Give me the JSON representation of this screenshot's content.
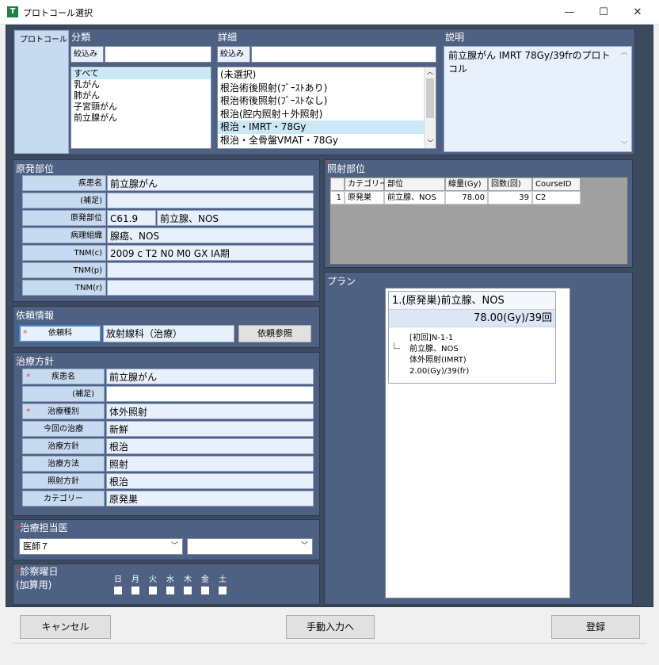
{
  "window": {
    "title": "プロトコール選択",
    "icon_letter": "T",
    "minimize": "—",
    "maximize": "☐",
    "close": "✕"
  },
  "protocol": {
    "tab_label": "プロトコール",
    "bunrui": {
      "title": "分類",
      "filter_label": "絞込み",
      "filter_value": "",
      "items": [
        "すべて",
        "乳がん",
        "肺がん",
        "子宮頸がん",
        "前立腺がん"
      ],
      "selected": 0
    },
    "shosai": {
      "title": "詳細",
      "filter_label": "絞込み",
      "filter_value": "",
      "items": [
        "(未選択)",
        "根治術後照射(ﾌﾞｰｽﾄあり)",
        "根治術後照射(ﾌﾞｰｽﾄなし)",
        "根治(腔内照射＋外照射)",
        "根治・IMRT・78Gy",
        "根治・全骨盤VMAT・78Gy"
      ],
      "selected": 4
    },
    "setsumei": {
      "title": "説明",
      "text": "前立腺がん IMRT 78Gy/39frのプロトコル"
    }
  },
  "genpatsu": {
    "title": "原発部位",
    "rows": [
      {
        "label": "疾患名",
        "value": "前立腺がん"
      },
      {
        "label": "(補足)",
        "value": ""
      },
      {
        "label": "原発部位",
        "value": "C61.9",
        "value2": "前立腺、NOS"
      },
      {
        "label": "病理組織",
        "value": "腺癌、NOS"
      },
      {
        "label": "TNM(c)",
        "value": "2009 c T2 N0 M0 GX ⅠA期"
      },
      {
        "label": "TNM(p)",
        "value": ""
      },
      {
        "label": "TNM(r)",
        "value": ""
      }
    ]
  },
  "irai": {
    "title": "依頼情報",
    "label": "依頼科",
    "value": "放射線科（治療）",
    "ref_button": "依頼参照"
  },
  "chiryo": {
    "title": "治療方針",
    "rows": [
      {
        "label": "疾患名",
        "value": "前立腺がん",
        "required": true
      },
      {
        "label": "(補足)",
        "value": "",
        "required": false
      },
      {
        "label": "治療種別",
        "value": "体外照射",
        "required": true
      },
      {
        "label": "今回の治療",
        "value": "新鮮",
        "required": false
      },
      {
        "label": "治療方針",
        "value": "根治",
        "required": false
      },
      {
        "label": "治療方法",
        "value": "照射",
        "required": false
      },
      {
        "label": "照射方針",
        "value": "根治",
        "required": false
      },
      {
        "label": "カテゴリー",
        "value": "原発巣",
        "required": false
      }
    ]
  },
  "tanto": {
    "title": "治療担当医",
    "doctor": "医師７",
    "second": ""
  },
  "shinsatsu": {
    "title": "診察曜日",
    "subtitle": "(加算用)",
    "days": [
      "日",
      "月",
      "火",
      "水",
      "木",
      "金",
      "土"
    ]
  },
  "shosha": {
    "title": "照射部位",
    "columns": [
      "",
      "カテゴリー",
      "部位",
      "線量(Gy)",
      "回数(回)",
      "CourseID"
    ],
    "rows": [
      [
        "1",
        "原発巣",
        "前立腺、NOS",
        "78.00",
        "39",
        "C2"
      ]
    ]
  },
  "plan": {
    "title": "プラン",
    "header": "1.(原発巣)前立腺、NOS",
    "dose": "78.00(Gy)/39回",
    "detail": [
      "[初回]N-1-1",
      "前立腺、NOS",
      "体外照射(IMRT)",
      "2.00(Gy)/39(fr)"
    ]
  },
  "footer": {
    "cancel": "キャンセル",
    "manual": "手動入力へ",
    "register": "登録"
  },
  "colors": {
    "panel": "#4e6183",
    "background": "#3c4a60",
    "label": "#c8daf0",
    "value": "#e8f0fc",
    "required": "#ff3b3b"
  }
}
